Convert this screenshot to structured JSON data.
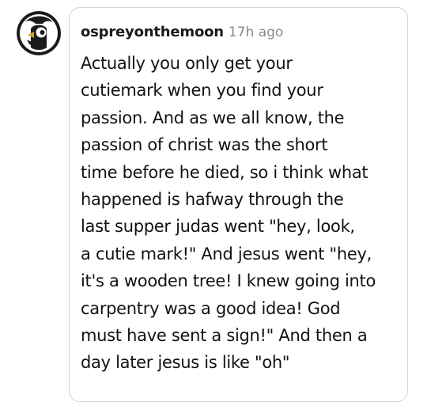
{
  "comment": {
    "username": "ospreyonthemoon",
    "timestamp": "17h ago",
    "text_lines": [
      "Actually you only get your",
      "cutiemark when you find your",
      "passion. And as we all know, the",
      "passion of christ was the short",
      "time before he died, so i think what",
      "happened is hafway through the",
      "last supper judas went \"hey, look,",
      "a cutie mark!\" And jesus went \"hey,",
      "it's a wooden tree! I knew going into",
      "carpentry was a good idea! God",
      "must have sent a sign!\" And then a",
      "day later jesus is like \"oh\""
    ]
  },
  "avatar": {
    "icon": "penguin-avatar-icon",
    "colors": {
      "ring": "#1b1b1b",
      "face": "#ffffff",
      "beak": "#d9a21b"
    }
  },
  "colors": {
    "bubble_border": "#d3d3d3",
    "username": "#1a1a1a",
    "timestamp": "#8a8a8a",
    "text": "#121212"
  }
}
